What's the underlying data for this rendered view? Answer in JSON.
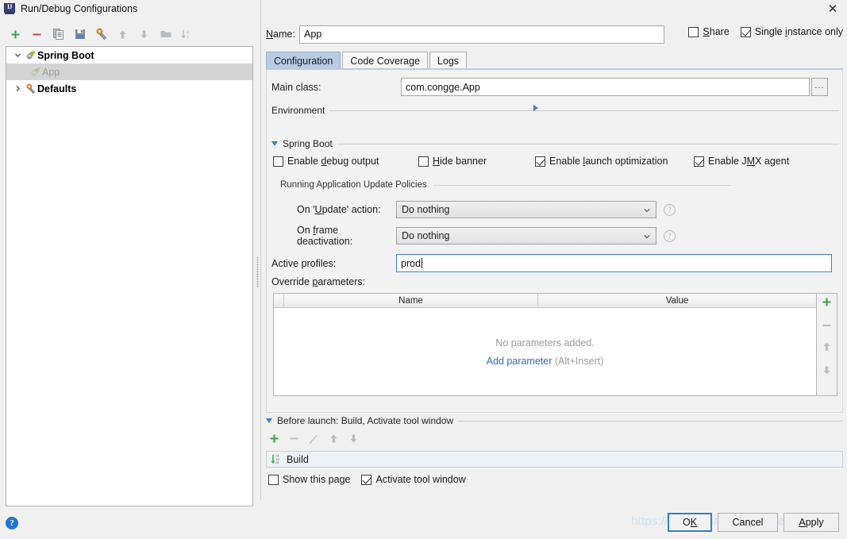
{
  "window": {
    "title": "Run/Debug Configurations",
    "icon": "idea-icon",
    "close_label": "✕"
  },
  "left_toolbar": {
    "buttons": [
      {
        "name": "add-configuration-button",
        "icon": "plus-icon",
        "glyph": "+"
      },
      {
        "name": "remove-configuration-button",
        "icon": "minus-icon",
        "glyph": "−"
      },
      {
        "name": "copy-configuration-button",
        "icon": "copy-icon",
        "glyph": "⎘"
      },
      {
        "name": "save-configuration-button",
        "icon": "save-icon",
        "glyph": "💾"
      },
      {
        "name": "edit-defaults-button",
        "icon": "wrench-icon",
        "glyph": "🔧"
      },
      {
        "name": "move-up-button",
        "icon": "arrow-up-icon",
        "glyph": "⬆"
      },
      {
        "name": "move-down-button",
        "icon": "arrow-down-icon",
        "glyph": "⬇"
      },
      {
        "name": "new-folder-button",
        "icon": "folder-icon",
        "glyph": "📁"
      },
      {
        "name": "sort-button",
        "icon": "sort-az-icon",
        "glyph": "↓az"
      }
    ]
  },
  "tree": {
    "nodes": [
      {
        "label": "Spring Boot",
        "expanded": true,
        "bold": true,
        "icon": "spring-boot-icon"
      },
      {
        "label": "App",
        "child": true,
        "selected": true,
        "icon": "spring-boot-icon"
      },
      {
        "label": "Defaults",
        "expanded": false,
        "bold": true,
        "icon": "wrench-icon"
      }
    ]
  },
  "name_field": {
    "label": "Name:",
    "mnemonic": "N",
    "value": "App"
  },
  "options": {
    "share": {
      "label": "Share",
      "mnemonic": "S",
      "checked": false
    },
    "single_instance": {
      "label": "Single instance only",
      "mnemonic": "i",
      "checked": true
    }
  },
  "tabs": [
    {
      "label": "Configuration",
      "active": true
    },
    {
      "label": "Code Coverage",
      "active": false
    },
    {
      "label": "Logs",
      "active": false
    }
  ],
  "configuration": {
    "main_class": {
      "label": "Main class:",
      "value": "com.congge.App",
      "browse_label": "..."
    },
    "environment_section": {
      "title": "Environment",
      "expanded": false
    },
    "spring_boot_section": {
      "title": "Spring Boot",
      "expanded": true
    },
    "checkboxes": [
      {
        "label": "Enable debug output",
        "mnemonic": "d",
        "checked": false
      },
      {
        "label": "Hide banner",
        "mnemonic": "H",
        "checked": false
      },
      {
        "label": "Enable launch optimization",
        "mnemonic": "l",
        "checked": true
      },
      {
        "label": "Enable JMX agent",
        "mnemonic": "M",
        "checked": true
      }
    ],
    "update_policies": {
      "title": "Running Application Update Policies",
      "on_update": {
        "label": "On 'Update' action:",
        "mnemonic": "U",
        "value": "Do nothing",
        "help": "?"
      },
      "on_frame_deactivation": {
        "label": "On frame deactivation:",
        "mnemonic": "f",
        "value": "Do nothing",
        "help": "?"
      }
    },
    "active_profiles": {
      "label": "Active profiles:",
      "value": "prod"
    },
    "override_parameters": {
      "label": "Override parameters:",
      "mnemonic": "p",
      "columns": [
        "",
        "Name",
        "Value"
      ],
      "rows": [],
      "empty_text": "No parameters added.",
      "add_link": "Add parameter",
      "add_hint": "(Alt+Insert)",
      "side_buttons": [
        {
          "name": "add-parameter-button",
          "icon": "plus-icon",
          "glyph": "+"
        },
        {
          "name": "remove-parameter-button",
          "icon": "minus-icon",
          "glyph": "−"
        },
        {
          "name": "move-parameter-up-button",
          "icon": "arrow-up-icon",
          "glyph": "⬆"
        },
        {
          "name": "move-parameter-down-button",
          "icon": "arrow-down-icon",
          "glyph": "⬇"
        }
      ]
    }
  },
  "before_launch": {
    "title": "Before launch: Build, Activate tool window",
    "expanded": true,
    "toolbar": [
      {
        "name": "add-task-button",
        "icon": "plus-icon",
        "glyph": "+"
      },
      {
        "name": "remove-task-button",
        "icon": "minus-icon",
        "glyph": "−"
      },
      {
        "name": "edit-task-button",
        "icon": "pencil-icon",
        "glyph": "✎"
      },
      {
        "name": "task-up-button",
        "icon": "arrow-up-icon",
        "glyph": "⬆"
      },
      {
        "name": "task-down-button",
        "icon": "arrow-down-icon",
        "glyph": "⬇"
      }
    ],
    "tasks": [
      {
        "label": "Build",
        "icon": "build-icon"
      }
    ],
    "show_this_page": {
      "label": "Show this page",
      "checked": false
    },
    "activate_tool_window": {
      "label": "Activate tool window",
      "checked": true
    }
  },
  "dialog_buttons": {
    "help": "?",
    "ok": "OK",
    "cancel": "Cancel",
    "apply": "Apply"
  },
  "watermark": "https://blog.csdn.net/congge_study",
  "colors": {
    "accent": "#2f7fd0",
    "tab_active": "#b8cce4",
    "link": "#2a6ebb",
    "green": "#3aa544",
    "red": "#c9504a",
    "window_bg": "#f0f0f0"
  }
}
